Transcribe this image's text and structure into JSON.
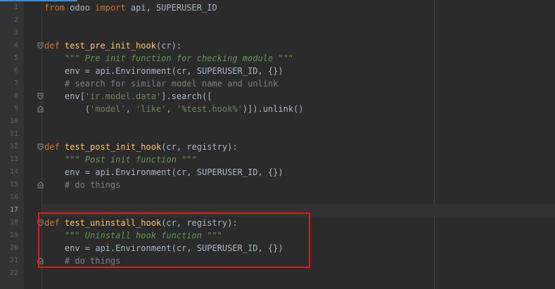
{
  "editor": {
    "lines": [
      {
        "n": "1",
        "tokens": [
          {
            "t": "from",
            "c": "kw"
          },
          {
            "t": " odoo ",
            "c": "plain"
          },
          {
            "t": "import",
            "c": "kw"
          },
          {
            "t": " api, SUPERUSER_ID",
            "c": "plain"
          }
        ]
      },
      {
        "n": "2",
        "tokens": []
      },
      {
        "n": "3",
        "tokens": []
      },
      {
        "n": "4",
        "tokens": [
          {
            "t": "def ",
            "c": "kw"
          },
          {
            "t": "test_pre_init_hook",
            "c": "fn"
          },
          {
            "t": "(cr):",
            "c": "plain"
          }
        ],
        "fold": "open"
      },
      {
        "n": "5",
        "tokens": [
          {
            "t": "    ",
            "c": "plain"
          },
          {
            "t": "\"\"\" Pre init function for checking module \"\"\"",
            "c": "doc"
          }
        ]
      },
      {
        "n": "6",
        "tokens": [
          {
            "t": "    env = api.Environment(cr, SUPERUSER_ID, {})",
            "c": "plain"
          }
        ]
      },
      {
        "n": "7",
        "tokens": [
          {
            "t": "    ",
            "c": "plain"
          },
          {
            "t": "# search for similar model name and unlink",
            "c": "cmt"
          }
        ]
      },
      {
        "n": "8",
        "tokens": [
          {
            "t": "    env[",
            "c": "plain"
          },
          {
            "t": "'ir.model.data'",
            "c": "str"
          },
          {
            "t": "].search([",
            "c": "plain"
          }
        ],
        "fold": "open"
      },
      {
        "n": "9",
        "tokens": [
          {
            "t": "        (",
            "c": "plain"
          },
          {
            "t": "'model'",
            "c": "str"
          },
          {
            "t": ", ",
            "c": "plain"
          },
          {
            "t": "'like'",
            "c": "str"
          },
          {
            "t": ", ",
            "c": "plain"
          },
          {
            "t": "'%test.hook%'",
            "c": "str"
          },
          {
            "t": ")]).unlink()",
            "c": "plain"
          }
        ],
        "fold": "close"
      },
      {
        "n": "10",
        "tokens": []
      },
      {
        "n": "11",
        "tokens": []
      },
      {
        "n": "12",
        "tokens": [
          {
            "t": "def ",
            "c": "kw"
          },
          {
            "t": "test_post_init_hook",
            "c": "fn"
          },
          {
            "t": "(cr, ",
            "c": "plain"
          },
          {
            "t": "registry",
            "c": "param"
          },
          {
            "t": "):",
            "c": "plain"
          }
        ],
        "fold": "open"
      },
      {
        "n": "13",
        "tokens": [
          {
            "t": "    ",
            "c": "plain"
          },
          {
            "t": "\"\"\" Post init function \"\"\"",
            "c": "doc"
          }
        ]
      },
      {
        "n": "14",
        "tokens": [
          {
            "t": "    env = api.Environment(cr, SUPERUSER_ID, {})",
            "c": "plain"
          }
        ]
      },
      {
        "n": "15",
        "tokens": [
          {
            "t": "    ",
            "c": "plain"
          },
          {
            "t": "# do things",
            "c": "cmt"
          }
        ],
        "fold": "close"
      },
      {
        "n": "16",
        "tokens": []
      },
      {
        "n": "17",
        "tokens": [],
        "active": true
      },
      {
        "n": "18",
        "tokens": [
          {
            "t": "def ",
            "c": "kw"
          },
          {
            "t": "test_uninstall_hook",
            "c": "fn"
          },
          {
            "t": "(cr, ",
            "c": "plain"
          },
          {
            "t": "registry",
            "c": "param"
          },
          {
            "t": "):",
            "c": "plain"
          }
        ],
        "fold": "open"
      },
      {
        "n": "19",
        "tokens": [
          {
            "t": "    ",
            "c": "plain"
          },
          {
            "t": "\"\"\" Uninstall hook function \"\"\"",
            "c": "doc"
          }
        ]
      },
      {
        "n": "20",
        "tokens": [
          {
            "t": "    env = api.Environment(cr, SUPERUSER_ID, {})",
            "c": "plain"
          }
        ]
      },
      {
        "n": "21",
        "tokens": [
          {
            "t": "    ",
            "c": "plain"
          },
          {
            "t": "# do things",
            "c": "cmt"
          }
        ],
        "fold": "close"
      },
      {
        "n": "22",
        "tokens": []
      }
    ]
  },
  "colors": {
    "background": "#2b2b2b",
    "keyword": "#cc7832",
    "function": "#ffc66d",
    "docstring": "#629755",
    "comment": "#808080",
    "string": "#6a8759",
    "highlight_box": "#e21b1b"
  }
}
